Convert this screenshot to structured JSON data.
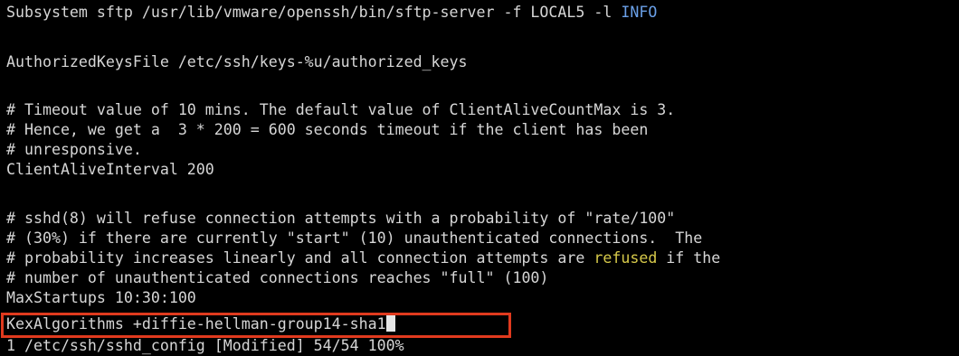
{
  "terminal": {
    "lines": [
      {
        "text": "Subsystem sftp /usr/lib/vmware/openssh/bin/sftp-server -f LOCAL5 -l ",
        "highlight": "INFO"
      },
      {
        "text": ""
      },
      {
        "text": "AuthorizedKeysFile /etc/ssh/keys-%u/authorized_keys"
      },
      {
        "text": ""
      },
      {
        "text": "# Timeout value of 10 mins. The default value of ClientAliveCountMax is 3."
      },
      {
        "text": "# Hence, we get a  3 * 200 = 600 seconds timeout if the client has been"
      },
      {
        "text": "# unresponsive."
      },
      {
        "text": "ClientAliveInterval 200"
      },
      {
        "text": ""
      },
      {
        "text": "# sshd(8) will refuse connection attempts with a probability of \"rate/100\""
      },
      {
        "text": "# (30%) if there are currently \"start\" (10) unauthenticated connections.  The"
      },
      {
        "pre": "# probability increases linearly and all connection attempts are ",
        "highlight": "refused",
        "post": " if the"
      },
      {
        "text": "# number of unauthenticated connections reaches \"full\" (100)"
      },
      {
        "text": "MaxStartups 10:30:100"
      },
      {
        "text": "KexAlgorithms +diffie-hellman-group14-sha1"
      },
      {
        "text": "1 /etc/ssh/sshd_config [Modified] 54/54 100%"
      }
    ]
  },
  "colors": {
    "background": "#000000",
    "text": "#d6d6d6",
    "keyword_blue": "#6aa0e8",
    "keyword_yellow": "#d6c94a",
    "highlight_box": "#e03a1e"
  }
}
